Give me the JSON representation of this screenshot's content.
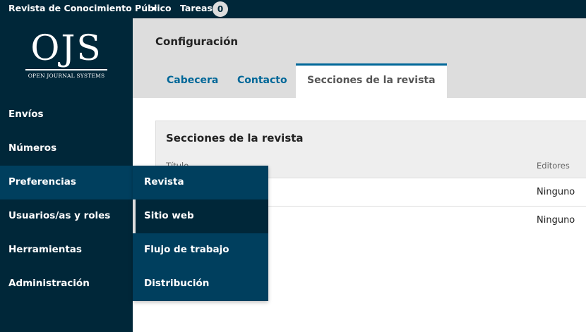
{
  "topbar": {
    "site_name": "Revista de Conocimiento Público",
    "tasks_label": "Tareas",
    "tasks_count": "0"
  },
  "logo": {
    "mark": "OJS",
    "subtitle": "OPEN JOURNAL SYSTEMS"
  },
  "sidebar": {
    "items": [
      {
        "label": "Envíos"
      },
      {
        "label": "Números"
      },
      {
        "label": "Preferencias"
      },
      {
        "label": "Usuarios/as y roles"
      },
      {
        "label": "Herramientas"
      },
      {
        "label": "Administración"
      }
    ]
  },
  "submenu": {
    "items": [
      {
        "label": "Revista"
      },
      {
        "label": "Sitio web"
      },
      {
        "label": "Flujo de trabajo"
      },
      {
        "label": "Distribución"
      }
    ]
  },
  "main": {
    "title": "Configuración",
    "tabs": [
      {
        "label": "Cabecera"
      },
      {
        "label": "Contacto"
      },
      {
        "label": "Secciones de la revista"
      }
    ]
  },
  "panel": {
    "title": "Secciones de la revista",
    "columns": {
      "title": "Título",
      "editors": "Editores"
    },
    "rows": [
      {
        "title": "",
        "editors": "Ninguno"
      },
      {
        "title": "",
        "editors": "Ninguno"
      }
    ]
  },
  "colors": {
    "nav_bg": "#002739",
    "nav_active": "#003f5e",
    "link": "#006798",
    "header_bg": "#dddddd"
  }
}
